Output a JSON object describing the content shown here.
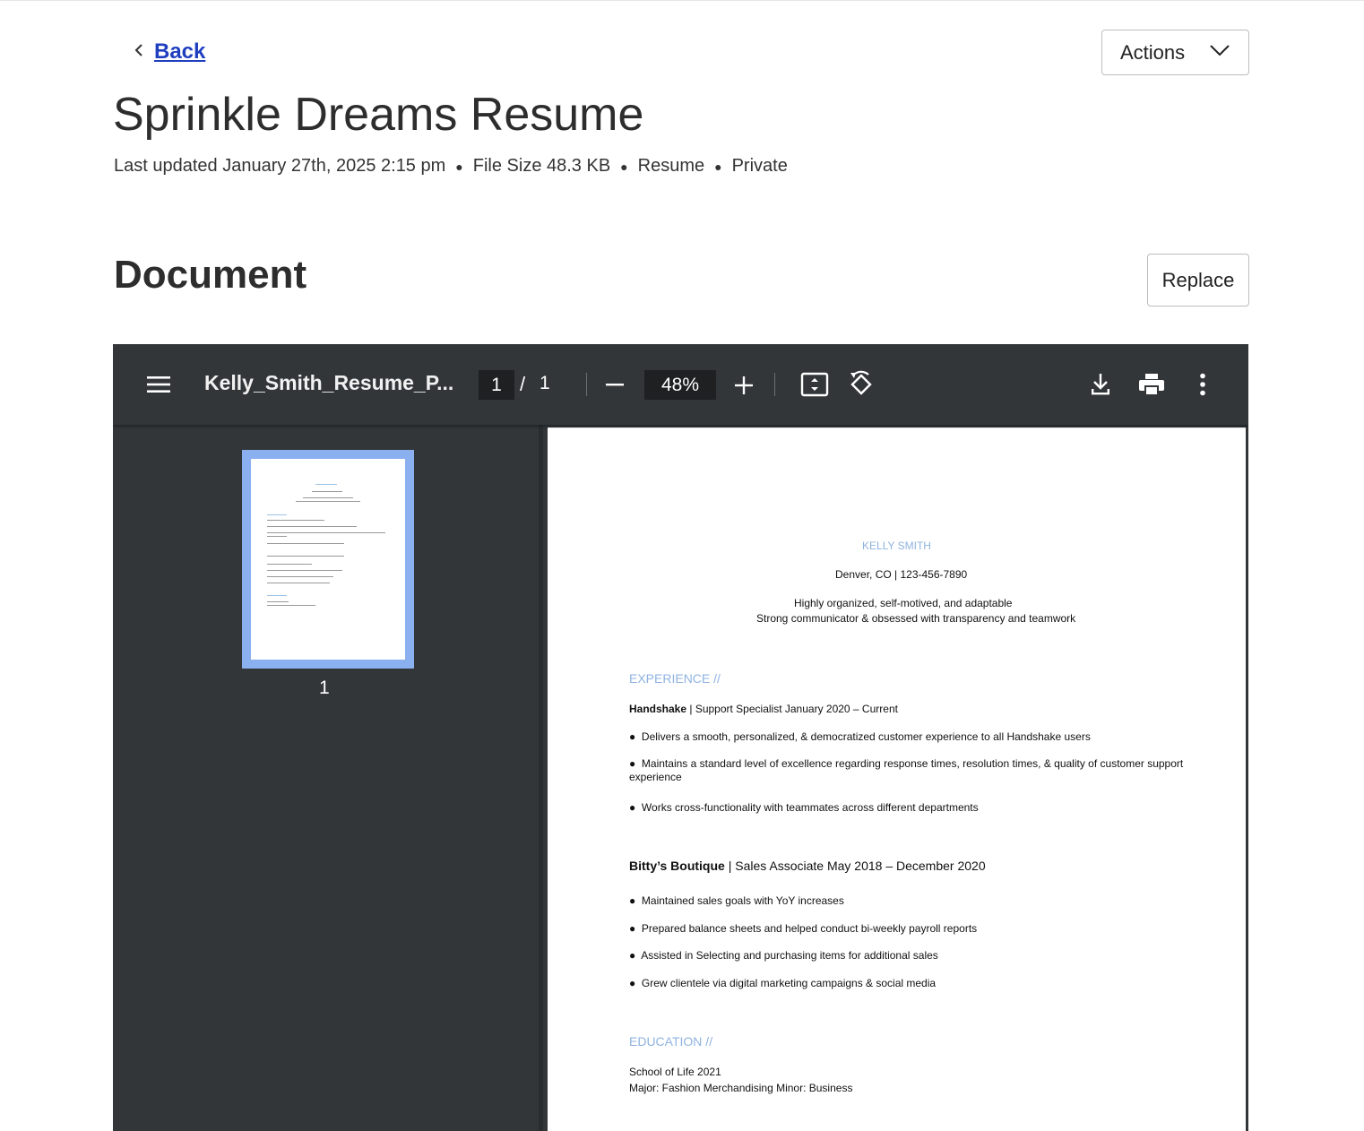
{
  "nav": {
    "back_label": "Back"
  },
  "header": {
    "actions_label": "Actions",
    "title": "Sprinkle Dreams Resume",
    "meta": {
      "updated": "Last updated January 27th, 2025 2:15 pm",
      "file_size": "File Size 48.3 KB",
      "type": "Resume",
      "visibility": "Private"
    }
  },
  "document_section": {
    "title": "Document",
    "replace_label": "Replace"
  },
  "viewer": {
    "filename": "Kelly_Smith_Resume_P...",
    "current_page": "1",
    "page_sep": "/",
    "total_pages": "1",
    "zoom": "48%",
    "thumbnail_label": "1",
    "icons": [
      "menu-icon",
      "zoom-out-icon",
      "zoom-in-icon",
      "fit-page-icon",
      "rotate-icon",
      "download-icon",
      "print-icon",
      "more-vert-icon"
    ]
  },
  "resume": {
    "name": "KELLY SMITH",
    "contact": "Denver, CO | 123-456-7890",
    "summary1": "Highly organized, self-motived, and adaptable",
    "summary2": "Strong communicator & obsessed with transparency and teamwork",
    "experience_heading": "EXPERIENCE //",
    "job1_company": "Handshake",
    "job1_rest": " | Support Specialist January 2020 – Current",
    "job1_bullets": [
      "Delivers a smooth, personalized, & democratized customer experience to all Handshake users",
      "Maintains a standard level of excellence regarding response times, resolution times, & quality of customer support",
      "experience",
      "Works cross-functionality with teammates across different departments"
    ],
    "job2_company": "Bitty’s Boutique",
    "job2_rest": " | Sales Associate May 2018 – December 2020",
    "job2_bullets": [
      "Maintained sales goals with YoY increases",
      "Prepared balance sheets and helped conduct bi-weekly payroll reports",
      "Assisted in Selecting and purchasing items for additional sales",
      "Grew clientele via digital marketing campaigns & social media"
    ],
    "education_heading": "EDUCATION //",
    "edu1": "School of Life 2021",
    "edu2": "Major: Fashion Merchandising Minor: Business"
  },
  "colors": {
    "link": "#1f3fbf",
    "viewer_bg": "#323639",
    "thumb_highlight": "#8ab0f0",
    "resume_heading": "#8fb3e0"
  }
}
